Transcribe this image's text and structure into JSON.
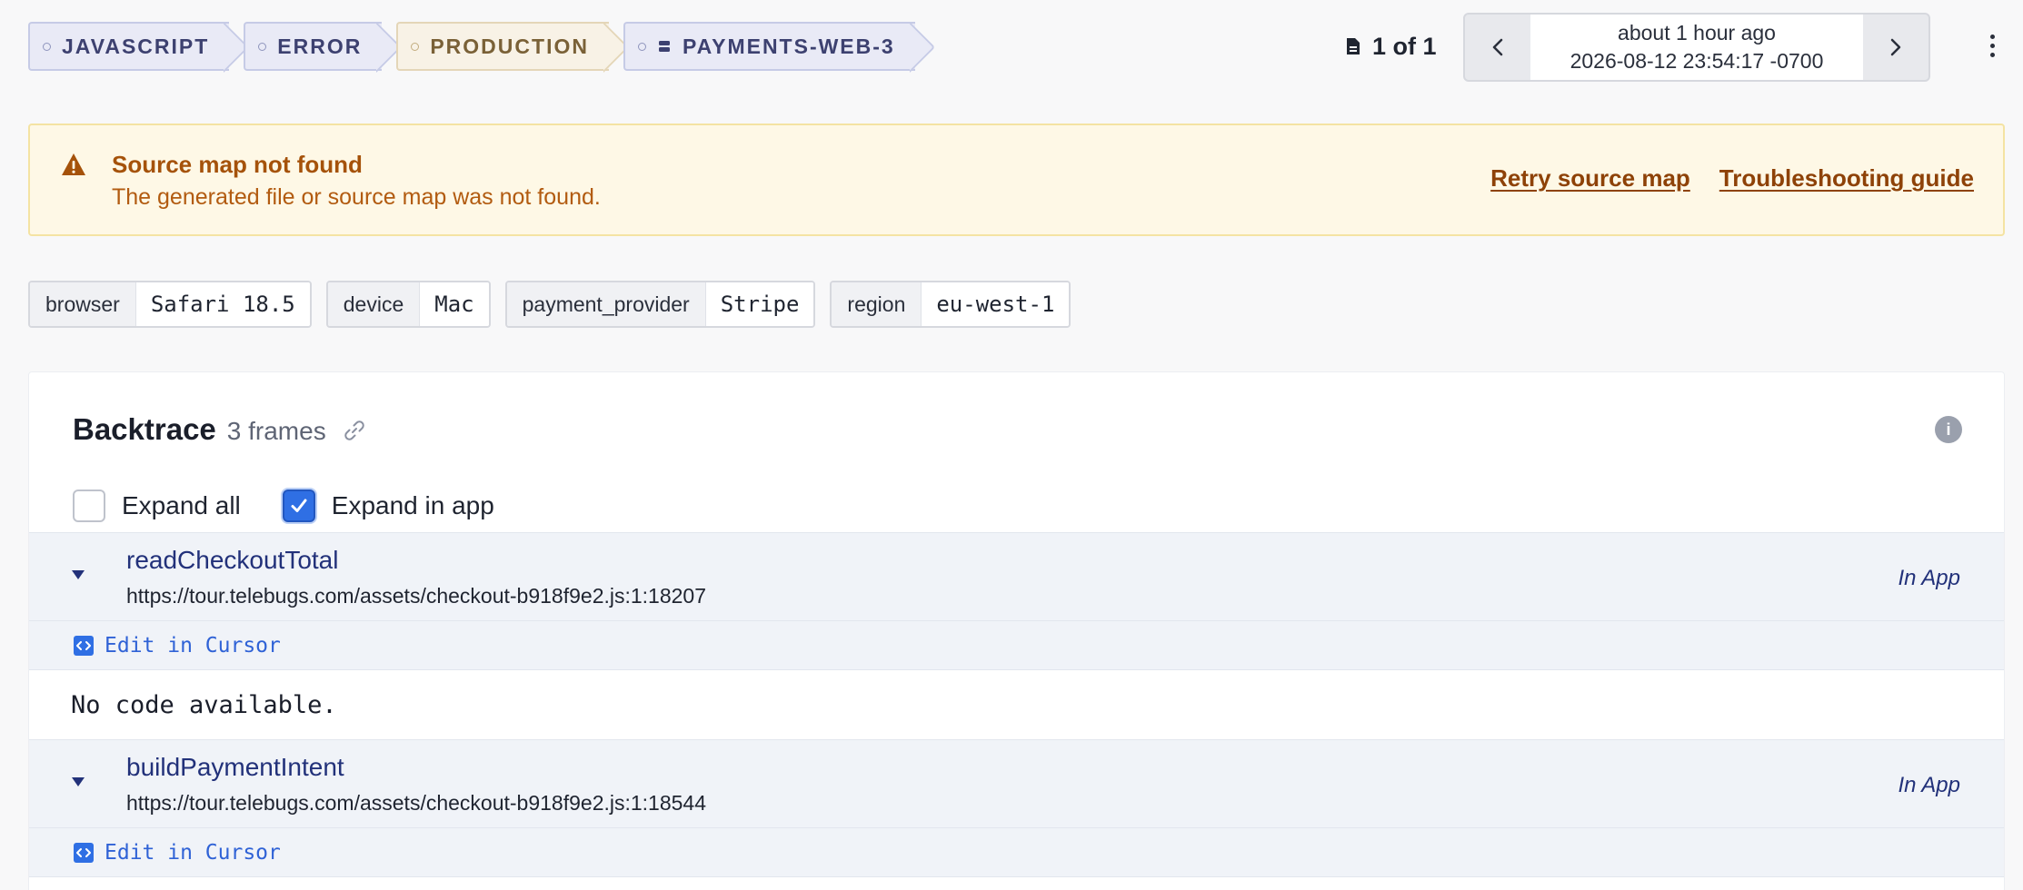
{
  "breadcrumbs": [
    {
      "label": "JAVASCRIPT",
      "kind": "platform"
    },
    {
      "label": "ERROR",
      "kind": "level"
    },
    {
      "label": "PRODUCTION",
      "kind": "environment"
    },
    {
      "label": "PAYMENTS-WEB-3",
      "kind": "server",
      "icon": "server-icon"
    }
  ],
  "pager": {
    "current": "1",
    "of_text": "of 1",
    "relative_time": "about 1 hour ago",
    "timestamp": "2026-08-12 23:54:17 -0700"
  },
  "alert": {
    "title": "Source map not found",
    "description": "The generated file or source map was not found.",
    "retry_label": "Retry source map",
    "guide_label": "Troubleshooting guide",
    "color": "#a5520a"
  },
  "tags": [
    {
      "key": "browser",
      "value": "Safari 18.5"
    },
    {
      "key": "device",
      "value": "Mac"
    },
    {
      "key": "payment_provider",
      "value": "Stripe"
    },
    {
      "key": "region",
      "value": "eu-west-1"
    }
  ],
  "backtrace": {
    "title": "Backtrace",
    "frame_count": "3 frames",
    "expand_all_label": "Expand all",
    "expand_all_checked": false,
    "expand_in_app_label": "Expand in app",
    "expand_in_app_checked": true,
    "frames": [
      {
        "function": "readCheckoutTotal",
        "location": "https://tour.telebugs.com/assets/checkout-b918f9e2.js:1:18207",
        "badge": "In App",
        "edit_label": "Edit in Cursor",
        "code": "No code available."
      },
      {
        "function": "buildPaymentIntent",
        "location": "https://tour.telebugs.com/assets/checkout-b918f9e2.js:1:18544",
        "badge": "In App",
        "edit_label": "Edit in Cursor"
      }
    ]
  },
  "colors": {
    "accent": "#2f6fe4",
    "function_name": "#22317a",
    "warning_bg": "#fef8e6"
  }
}
